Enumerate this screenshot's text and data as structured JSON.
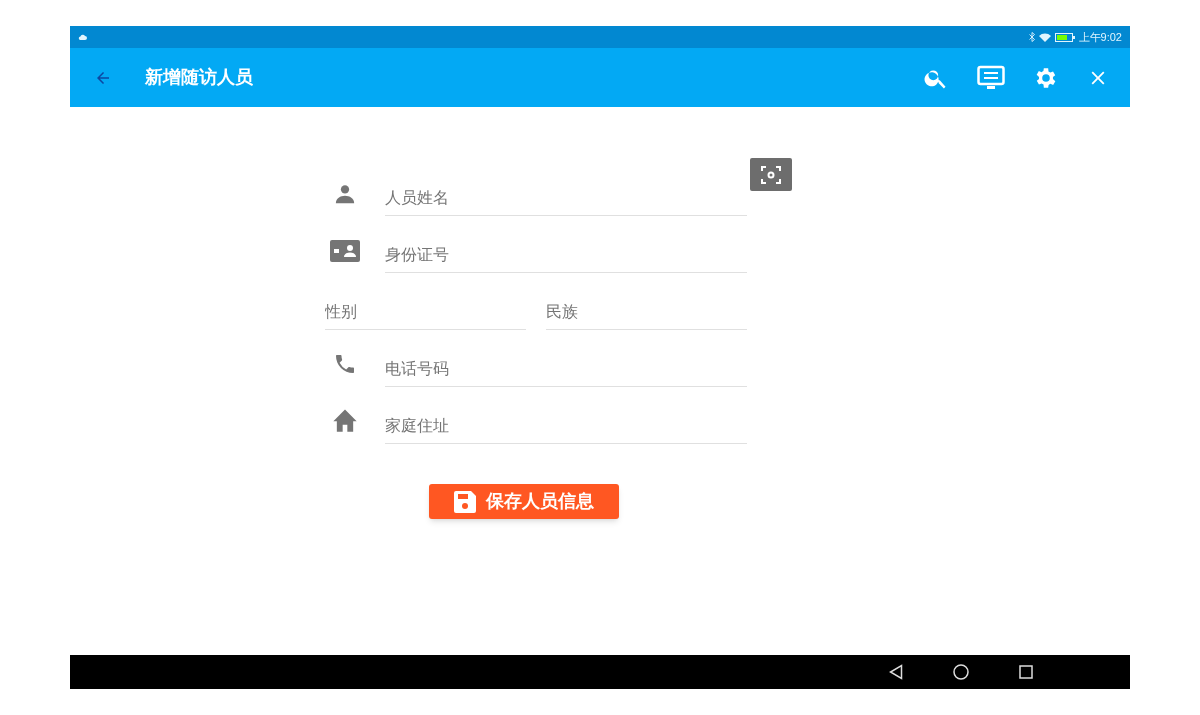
{
  "status_bar": {
    "time": "上午9:02"
  },
  "app_bar": {
    "title": "新增随访人员"
  },
  "form": {
    "rows": [
      {
        "kind": "icon_field",
        "fields": [
          {
            "placeholder": "人员姓名"
          }
        ]
      },
      {
        "kind": "icon_field",
        "fields": [
          {
            "placeholder": "身份证号"
          }
        ]
      },
      {
        "kind": "pair",
        "fields": [
          {
            "placeholder": "性别"
          },
          {
            "placeholder": "民族"
          }
        ]
      },
      {
        "kind": "icon_field",
        "fields": [
          {
            "placeholder": "电话号码"
          }
        ]
      },
      {
        "kind": "icon_field",
        "fields": [
          {
            "placeholder": "家庭住址"
          }
        ]
      }
    ],
    "save_button": {
      "label": "保存人员信息"
    }
  }
}
